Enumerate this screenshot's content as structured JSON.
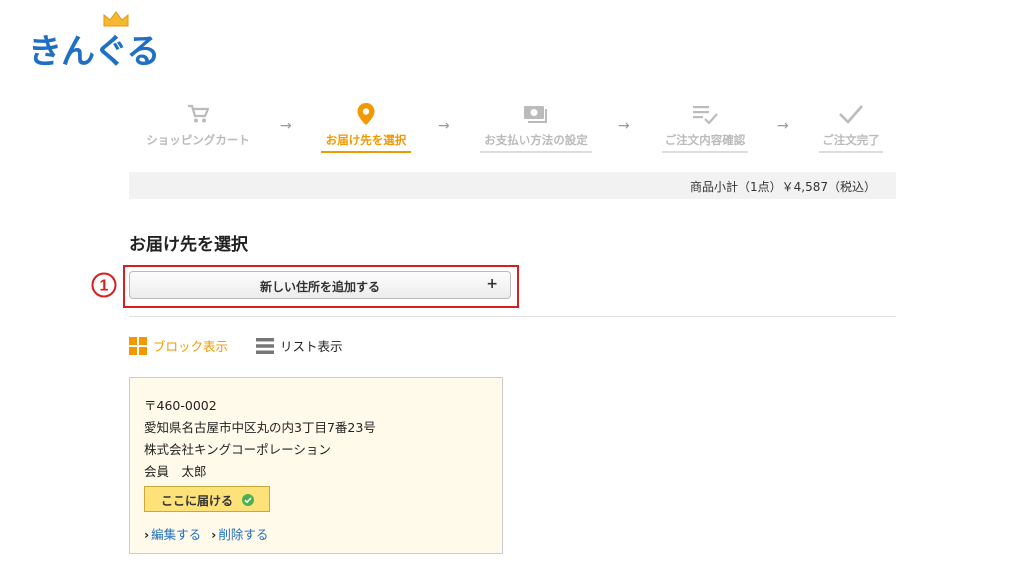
{
  "logo": {
    "text": "きんぐる"
  },
  "steps": [
    {
      "label": "ショッピングカート",
      "icon": "cart-icon",
      "state": "done"
    },
    {
      "label": "お届け先を選択",
      "icon": "location-pin-icon",
      "state": "active"
    },
    {
      "label": "お支払い方法の設定",
      "icon": "money-icon",
      "state": "future"
    },
    {
      "label": "ご注文内容確認",
      "icon": "checklist-icon",
      "state": "future"
    },
    {
      "label": "ご注文完了",
      "icon": "check-icon",
      "state": "future"
    }
  ],
  "subtotal": "商品小計（1点）￥4,587（税込）",
  "page_title": "お届け先を選択",
  "callout": "1",
  "add_address": {
    "label": "新しい住所を追加する",
    "plus": "+"
  },
  "view": {
    "block_label": "ブロック表示",
    "list_label": "リスト表示"
  },
  "address_card": {
    "postal": "〒460-0002",
    "address": "愛知県名古屋市中区丸の内3丁目7番23号",
    "company": "株式会社キングコーポレーション",
    "name": "会員　太郎",
    "deliver_label": "ここに届ける",
    "edit_label": "編集する",
    "delete_label": "削除する"
  },
  "colors": {
    "accent": "#f39800",
    "brand": "#1f6fc2",
    "callout": "#d81e1e",
    "link": "#1f6fc2"
  }
}
